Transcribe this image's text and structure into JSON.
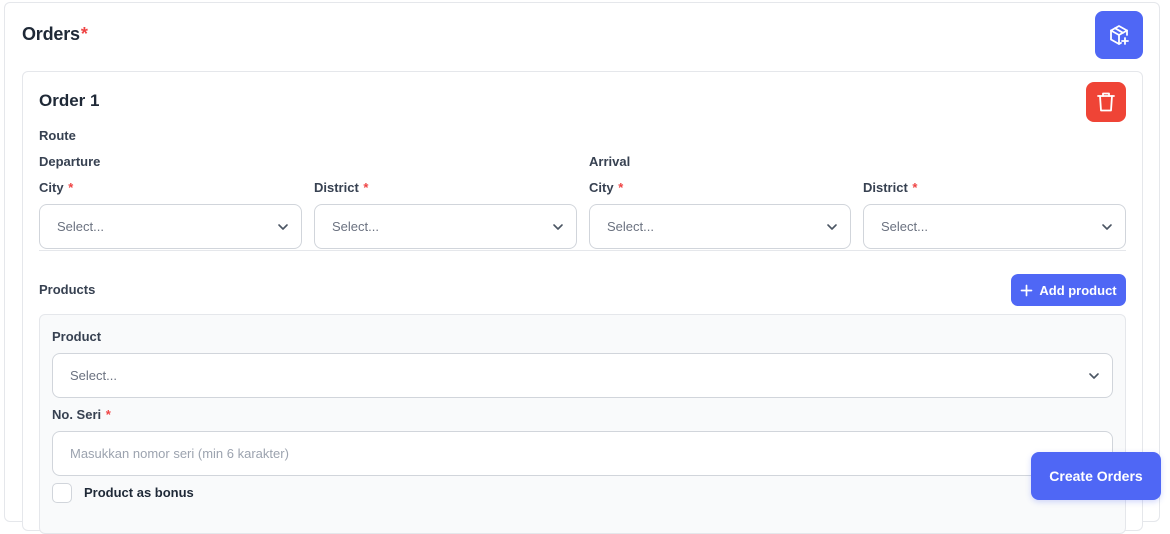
{
  "orders": {
    "title": "Orders",
    "required_mark": "*",
    "add_order_icon": "package-plus-icon"
  },
  "order": {
    "title": "Order 1",
    "delete_icon": "trash-icon",
    "route_label": "Route",
    "departure": {
      "label": "Departure",
      "city_label": "City",
      "city_placeholder": "Select...",
      "district_label": "District",
      "district_placeholder": "Select..."
    },
    "arrival": {
      "label": "Arrival",
      "city_label": "City",
      "city_placeholder": "Select...",
      "district_label": "District",
      "district_placeholder": "Select..."
    },
    "required_mark": "*"
  },
  "products": {
    "label": "Products",
    "add_button_label": "Add product",
    "add_button_icon": "plus-icon",
    "product_label": "Product",
    "product_placeholder": "Select...",
    "serial_label": "No. Seri",
    "serial_placeholder": "Masukkan nomor seri (min 6 karakter)",
    "bonus_label": "Product as bonus"
  },
  "actions": {
    "create_label": "Create Orders"
  },
  "colors": {
    "primary": "#4f67f5",
    "danger": "#ef4436",
    "required": "#ef4444"
  }
}
